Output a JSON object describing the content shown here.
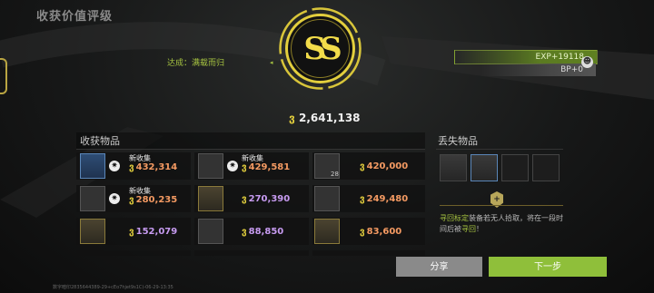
{
  "page_title": "收获价值评级",
  "achievement": "达成：满载而归",
  "rating": "SS",
  "total_value": "2,641,138",
  "exp": "EXP+19118",
  "bp": "BP+0",
  "collected_header": "收获物品",
  "lost_header": "丢失物品",
  "new_label": "新收集",
  "collected_items": [
    {
      "price": "432,314",
      "new": true,
      "color": "#f49a62"
    },
    {
      "price": "429,581",
      "new": true,
      "color": "#f49a62"
    },
    {
      "price": "420,000",
      "new": false,
      "qty": "28",
      "color": "#f49a62"
    },
    {
      "price": "280,235",
      "new": true,
      "color": "#f49a62"
    },
    {
      "price": "270,390",
      "new": false,
      "color": "#c79bf1"
    },
    {
      "price": "249,480",
      "new": false,
      "color": "#f49a62"
    },
    {
      "price": "152,079",
      "new": false,
      "color": "#c79bf1"
    },
    {
      "price": "88,850",
      "new": false,
      "color": "#c79bf1"
    },
    {
      "price": "83,600",
      "new": false,
      "color": "#f49a62"
    }
  ],
  "retrieve": {
    "keyword": "寻回标定",
    "text_a": "装备若无人拾取，将在一段时间后被",
    "keyword2": "寻回",
    "text_b": "！"
  },
  "buttons": {
    "share": "分享",
    "next": "下一步"
  },
  "footer": "数字暗印2835644389-29+cEo7hjet9s1C)-06-29-13:35",
  "icons": {
    "coin": "currency-coin-icon",
    "gear": "gear-icon",
    "retrieve": "shield-plus-icon",
    "avatar": "user-avatar-icon"
  }
}
